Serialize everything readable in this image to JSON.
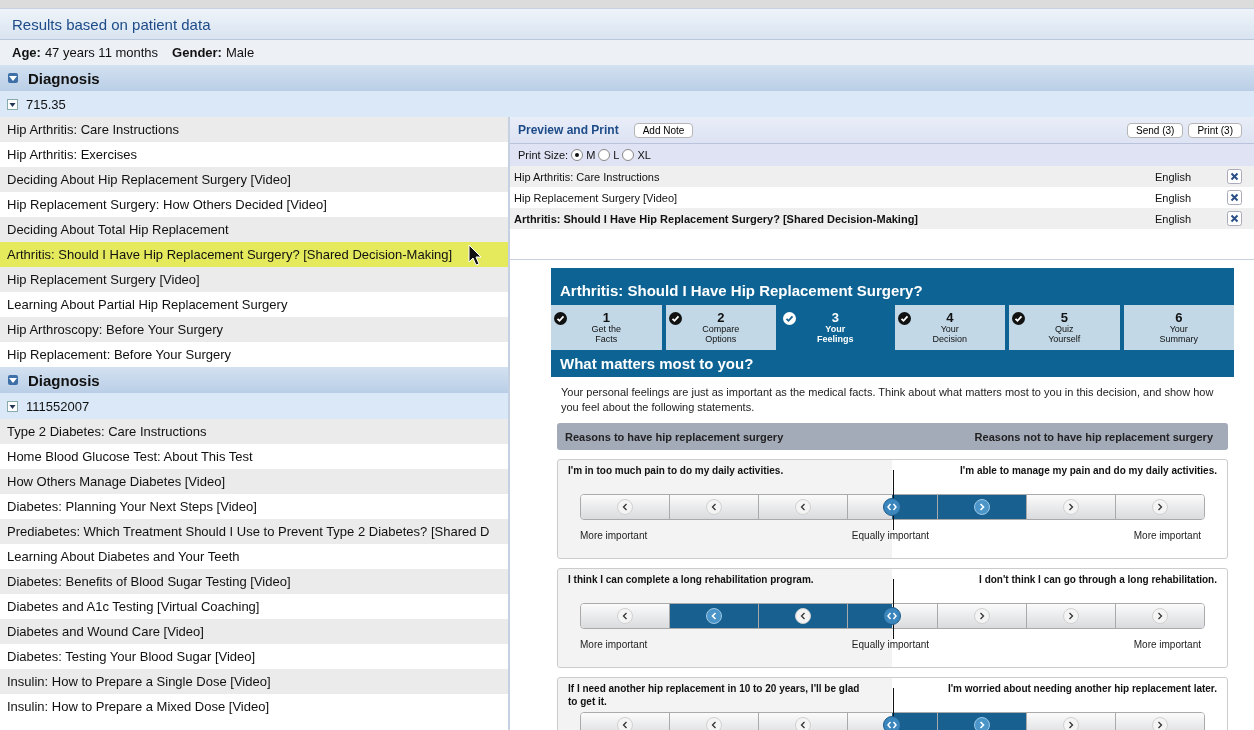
{
  "header": {
    "title": "Results based on patient data"
  },
  "patient": {
    "age_label": "Age:",
    "age": "47 years 11 months",
    "gender_label": "Gender:",
    "gender": "Male"
  },
  "diagnoses": [
    {
      "heading": "Diagnosis",
      "expanded": true,
      "code": "715.35",
      "items": [
        {
          "title": "Hip Arthritis: Care Instructions",
          "selected": false
        },
        {
          "title": "Hip Arthritis: Exercises",
          "selected": false
        },
        {
          "title": "Deciding About Hip Replacement Surgery [Video]",
          "selected": false
        },
        {
          "title": "Hip Replacement Surgery: How Others Decided [Video]",
          "selected": false
        },
        {
          "title": "Deciding About Total Hip Replacement",
          "selected": false
        },
        {
          "title": "Arthritis: Should I Have Hip Replacement Surgery? [Shared Decision-Making]",
          "selected": true
        },
        {
          "title": "Hip Replacement Surgery [Video]",
          "selected": false
        },
        {
          "title": "Learning About Partial Hip Replacement Surgery",
          "selected": false
        },
        {
          "title": "Hip Arthroscopy: Before Your Surgery",
          "selected": false
        },
        {
          "title": "Hip Replacement: Before Your Surgery",
          "selected": false
        }
      ]
    },
    {
      "heading": "Diagnosis",
      "expanded": true,
      "code": "111552007",
      "items": [
        {
          "title": "Type 2 Diabetes: Care Instructions",
          "selected": false
        },
        {
          "title": "Home Blood Glucose Test: About This Test",
          "selected": false
        },
        {
          "title": "How Others Manage Diabetes [Video]",
          "selected": false
        },
        {
          "title": "Diabetes: Planning Your Next Steps [Video]",
          "selected": false
        },
        {
          "title": "Prediabetes: Which Treatment Should I Use to Prevent Type 2 Diabetes? [Shared D",
          "selected": false
        },
        {
          "title": "Learning About Diabetes and Your Teeth",
          "selected": false
        },
        {
          "title": "Diabetes: Benefits of Blood Sugar Testing [Video]",
          "selected": false
        },
        {
          "title": "Diabetes and A1c Testing [Virtual Coaching]",
          "selected": false
        },
        {
          "title": "Diabetes and Wound Care [Video]",
          "selected": false
        },
        {
          "title": "Diabetes: Testing Your Blood Sugar [Video]",
          "selected": false
        },
        {
          "title": "Insulin: How to Prepare a Single Dose [Video]",
          "selected": false
        },
        {
          "title": "Insulin: How to Prepare a Mixed Dose [Video]",
          "selected": false
        }
      ]
    }
  ],
  "preview": {
    "title": "Preview and Print",
    "add_note": "Add Note",
    "send": "Send (3)",
    "print": "Print (3)",
    "print_size_label": "Print Size:",
    "sizes": [
      {
        "label": "M",
        "selected": true
      },
      {
        "label": "L",
        "selected": false
      },
      {
        "label": "XL",
        "selected": false
      }
    ],
    "rows": [
      {
        "title": "Hip Arthritis: Care Instructions",
        "language": "English",
        "bold": false
      },
      {
        "title": "Hip Replacement Surgery [Video]",
        "language": "English",
        "bold": false
      },
      {
        "title": "Arthritis: Should I Have Hip Replacement Surgery? [Shared Decision-Making]",
        "language": "English",
        "bold": true
      }
    ]
  },
  "decision_aid": {
    "title": "Arthritis: Should I Have Hip Replacement Surgery?",
    "steps": [
      {
        "number": "1",
        "label": "Get the Facts",
        "checked": true,
        "selected": false
      },
      {
        "number": "2",
        "label": "Compare Options",
        "checked": true,
        "selected": false
      },
      {
        "number": "3",
        "label": "Your Feelings",
        "checked": true,
        "selected": true
      },
      {
        "number": "4",
        "label": "Your Decision",
        "checked": true,
        "selected": false
      },
      {
        "number": "5",
        "label": "Quiz Yourself",
        "checked": true,
        "selected": false
      },
      {
        "number": "6",
        "label": "Your Summary",
        "checked": false,
        "selected": false
      }
    ],
    "section_title": "What matters most to you?",
    "intro": "Your personal feelings are just as important as the medical facts. Think about what matters most to you in this decision, and show how you feel about the following statements.",
    "reasons_for": "Reasons to have hip replacement surgery",
    "reasons_against": "Reasons not to have hip replacement surgery",
    "statements": [
      {
        "left": "I'm in too much pain to do my daily activities.",
        "right": "I'm able to manage my pain and do my daily activities.",
        "level": 0.667,
        "scale_left": "More important",
        "scale_mid": "Equally important",
        "scale_right": "More important"
      },
      {
        "left": "I think I can complete a long rehabilitation program.",
        "right": "I don't think I can go through a long rehabilitation.",
        "level": 0.167,
        "scale_left": "More important",
        "scale_mid": "Equally important",
        "scale_right": "More important"
      },
      {
        "left": "If I need another hip replacement in 10 to 20 years, I'll be glad to get it.",
        "right": "I'm worried about needing another hip replacement later.",
        "level": 0.667
      }
    ]
  }
}
